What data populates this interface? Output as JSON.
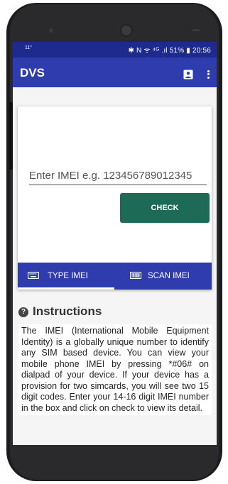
{
  "status_bar": {
    "left_text": "11°",
    "right_text": "✱ N ᯤ ⁴ᴳ .ıl 51% ▮ 20:56"
  },
  "app_bar": {
    "title": "DVS",
    "account_icon": "account-box-icon",
    "more_icon": "more-vert-icon"
  },
  "imei_form": {
    "placeholder": "Enter IMEI e.g. 123456789012345",
    "value": "",
    "check_label": "CHECK"
  },
  "tabs": [
    {
      "label": "TYPE IMEI",
      "icon": "keyboard-icon",
      "selected": true
    },
    {
      "label": "SCAN IMEI",
      "icon": "barcode-icon",
      "selected": false
    }
  ],
  "instructions": {
    "heading": "Instructions",
    "icon": "help-circle-icon",
    "body": "The IMEI (International Mobile Equipment Identity) is a globally unique number to identify any SIM based device. You can view your mobile phone IMEI by pressing *#06# on dialpad of your device. If your device has a provision for two simcards, you will see two 15 digit codes. Enter your 14-16 digit IMEI number in the box and click on check to view its detail."
  },
  "colors": {
    "status_bar": "#1f2a8f",
    "primary": "#2f3cae",
    "check_button": "#1d6b57",
    "phone_frame": "#1c1c1e"
  }
}
